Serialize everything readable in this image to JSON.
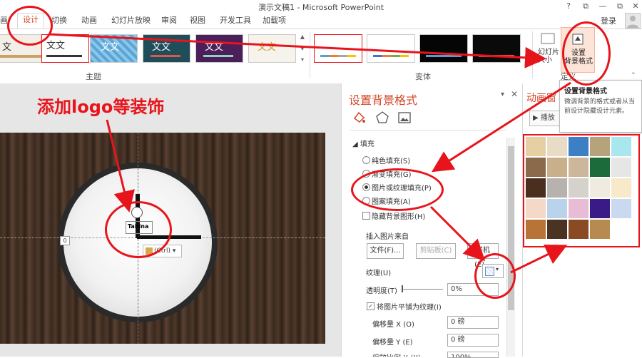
{
  "window": {
    "title": "演示文稿1 - Microsoft PowerPoint",
    "controls": [
      "?",
      "⧉",
      "—",
      "⧉",
      "✕"
    ]
  },
  "tabs": [
    "画",
    "设计",
    "切换",
    "动画",
    "幻灯片放映",
    "审阅",
    "视图",
    "开发工具",
    "加载项"
  ],
  "active_tab_index": 1,
  "login_label": "登录",
  "ribbon": {
    "themes_group_label": "主题",
    "variants_group_label": "变体",
    "customize_group_label": "定义",
    "theme_sample_text": "文文",
    "slide_size_label": "幻灯片\n大小",
    "bg_format_button_label": "设置\n背景格式"
  },
  "annotation": {
    "heading": "添加logo等装饰"
  },
  "slide": {
    "guide_label": "0",
    "shape_text": "Tahina",
    "paste_label": "(Ctrl)"
  },
  "pane": {
    "title": "设置背景格式",
    "section_fill": "填充",
    "options": [
      "纯色填充(S)",
      "渐变填充(G)",
      "图片或纹理填充(P)",
      "图案填充(A)"
    ],
    "selected_option_index": 2,
    "hide_bg_graphics": "隐藏背景图形(H)",
    "insert_from_label": "插入图片来自",
    "file_button": "文件(F)...",
    "clipboard_button": "剪贴板(C)",
    "online_button": "联机(E)...",
    "texture_label": "纹理(U)",
    "transparency_label": "透明度(T)",
    "transparency_value": "0%",
    "tile_label": "将图片平铺为纹理(I)",
    "offset_x_label": "偏移量 X (O)",
    "offset_x_value": "0 磅",
    "offset_y_label": "偏移量 Y (E)",
    "offset_y_value": "0 磅",
    "scale_x_label": "缩放比例 X (X)",
    "scale_x_value": "100%"
  },
  "anim_pane": {
    "title": "动画窗",
    "play_label": "播放"
  },
  "tooltip": {
    "title": "设置背景格式",
    "body": "微调背景的格式或者从当前设计隐藏设计元素。"
  },
  "colors": {
    "accent": "#d24726",
    "annotation_red": "#e8141b"
  }
}
